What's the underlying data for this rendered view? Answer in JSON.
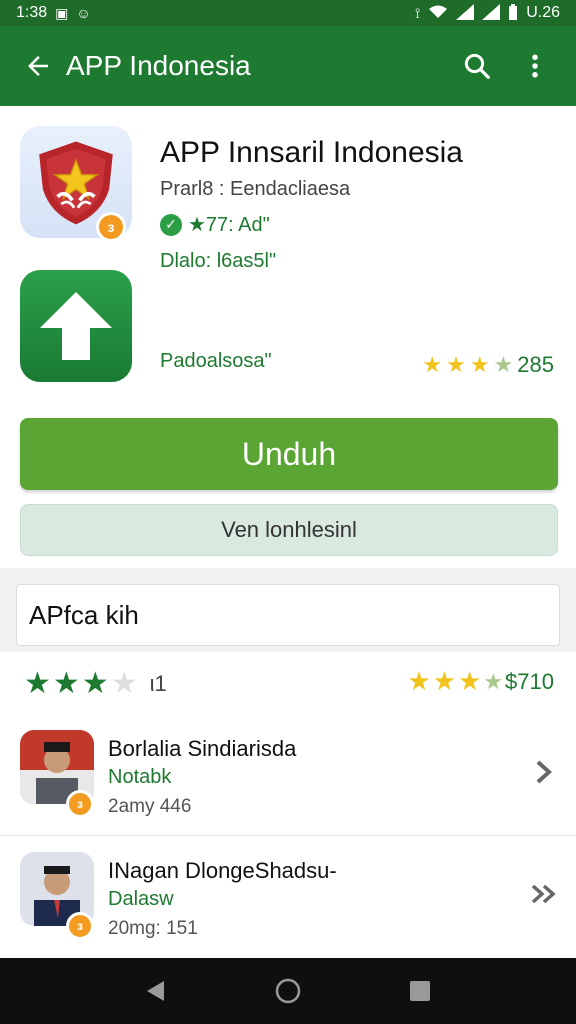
{
  "status_bar": {
    "time": "1:38",
    "battery_text": "U.26"
  },
  "app_bar": {
    "title": "APP Indonesia",
    "back_icon": "arrow-left-icon",
    "search_icon": "search-icon",
    "menu_icon": "more-vert-icon"
  },
  "app": {
    "title": "APP Innsaril Indonesia",
    "subtitle": "Prarl8 : Eendacliaesa",
    "meta": "★77: Ad\"",
    "downloads": "Dlalo: l6as5l\"",
    "publisher": "Padoalsosa\"",
    "rating_value": "285",
    "badge_symbol": "ɜ"
  },
  "buttons": {
    "primary": "Unduh",
    "secondary": "Ven lonhlesinl"
  },
  "section": {
    "title": "APfca kih"
  },
  "ratings_row": {
    "left_text": "ι1",
    "right_text": "$710"
  },
  "list": [
    {
      "name": "Borlalia Sindiarisda",
      "role": "Notabk",
      "meta": "2amy 446"
    },
    {
      "name": "INagan DlongeShadsu-",
      "role": "Dalasw",
      "meta": "20mg: 151"
    }
  ],
  "colors": {
    "primary_green": "#1f7a31",
    "button_green": "#5ba534",
    "badge_orange": "#f39b20",
    "star_yellow": "#f2c31c"
  }
}
